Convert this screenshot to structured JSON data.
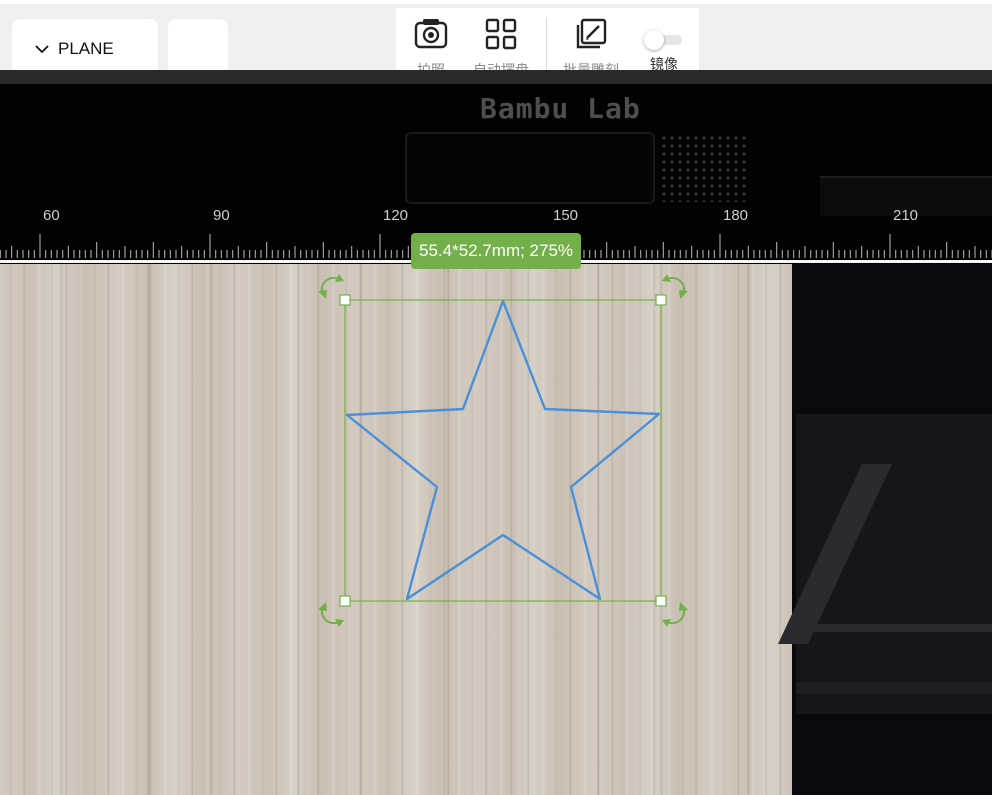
{
  "header": {
    "material_select": {
      "label": "PLANE",
      "icon": "chevron-down-icon"
    },
    "toolbar": {
      "items": [
        {
          "label": "拍照",
          "icon": "camera-icon"
        },
        {
          "label": "自动摆盘",
          "icon": "grid-icon"
        },
        {
          "label": "批量雕刻",
          "icon": "batch-engrave-icon"
        }
      ],
      "mirror": {
        "label": "镜像",
        "enabled": false
      }
    }
  },
  "camera_view": {
    "brand": "Bambu Lab",
    "ruler": {
      "labels": [
        "60",
        "90",
        "120",
        "150",
        "180",
        "210"
      ]
    },
    "selection": {
      "size_label": "55.4*52.7mm; 275%",
      "shape": "star",
      "handle_icon": "rotate-icon"
    }
  },
  "colors": {
    "accent": "#73b04a",
    "star_stroke": "#4a90d9",
    "selection_box": "#73b04a"
  }
}
